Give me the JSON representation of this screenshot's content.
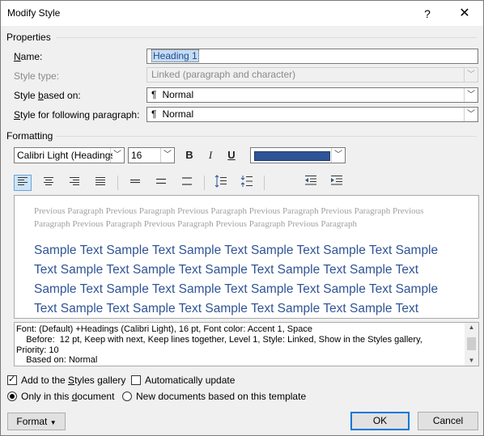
{
  "window": {
    "title": "Modify Style",
    "help_symbol": "?",
    "close_symbol": "✕"
  },
  "properties": {
    "section_label": "Properties",
    "name_label": "Name:",
    "name_value": "Heading 1",
    "style_type_label": "Style type:",
    "style_type_value": "Linked (paragraph and character)",
    "based_on_label": "Style based on:",
    "based_on_value": "Normal",
    "following_label": "Style for following paragraph:",
    "following_value": "Normal"
  },
  "formatting": {
    "section_label": "Formatting",
    "font_name": "Calibri Light (Headings",
    "font_size": "16",
    "bold": "B",
    "italic": "I",
    "underline": "U",
    "font_color": "#2f5496"
  },
  "preview": {
    "previous_paragraph": "Previous Paragraph Previous Paragraph Previous Paragraph Previous Paragraph Previous Paragraph Previous Paragraph Previous Paragraph Previous Paragraph Previous Paragraph Previous Paragraph",
    "sample_text": "Sample Text Sample Text Sample Text Sample Text Sample Text Sample Text Sample Text Sample Text Sample Text Sample Text Sample Text Sample Text Sample Text Sample Text Sample Text Sample Text Sample Text Sample Text Sample Text Sample Text Sample Text Sample Text Sample Text Sample Text Sample Text Sample Text Sample Text Sample Text"
  },
  "description": {
    "text": "Font: (Default) +Headings (Calibri Light), 16 pt, Font color: Accent 1, Space\n    Before:  12 pt, Keep with next, Keep lines together, Level 1, Style: Linked, Show in the Styles gallery,\nPriority: 10\n    Based on: Normal"
  },
  "options": {
    "add_to_gallery": "Add to the Styles gallery",
    "auto_update": "Automatically update",
    "only_this_document": "Only in this document",
    "new_documents": "New documents based on this template"
  },
  "buttons": {
    "format": "Format",
    "ok": "OK",
    "cancel": "Cancel"
  }
}
